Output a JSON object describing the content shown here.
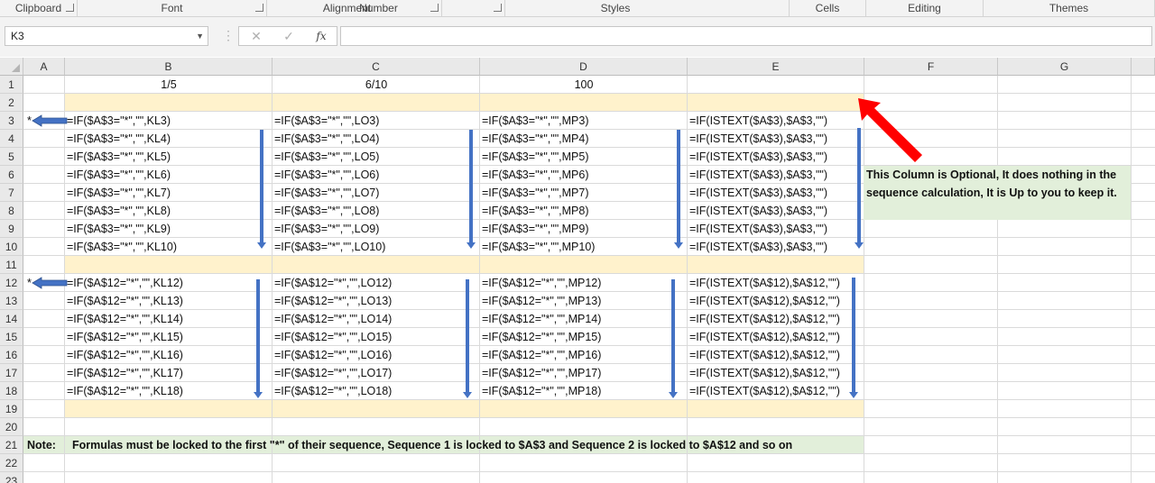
{
  "ribbon": {
    "groups": [
      {
        "label": "Clipboard",
        "launcher": true
      },
      {
        "label": "Font",
        "launcher": true
      },
      {
        "label": "Alignment",
        "launcher": true
      },
      {
        "label": "Number",
        "launcher": true
      },
      {
        "label": "Styles",
        "launcher": false
      },
      {
        "label": "Cells",
        "launcher": false
      },
      {
        "label": "Editing",
        "launcher": false
      },
      {
        "label": "Themes",
        "launcher": false
      }
    ]
  },
  "formula_bar": {
    "name_box": "K3",
    "cancel_icon": "close-icon",
    "enter_icon": "check-icon",
    "fx_label": "fx",
    "formula": ""
  },
  "columns": [
    "A",
    "B",
    "C",
    "D",
    "E",
    "F",
    "G"
  ],
  "rows": [
    "1",
    "2",
    "3",
    "4",
    "5",
    "6",
    "7",
    "8",
    "9",
    "10",
    "11",
    "12",
    "13",
    "14",
    "15",
    "16",
    "17",
    "18",
    "19",
    "20",
    "21",
    "22",
    "23"
  ],
  "cells": {
    "row1": {
      "B": "1/5",
      "C": "6/10",
      "D": "100"
    },
    "seq1": {
      "A3": "*",
      "B": [
        "=IF($A$3=\"*\",\"\",KL3)",
        "=IF($A$3=\"*\",\"\",KL4)",
        "=IF($A$3=\"*\",\"\",KL5)",
        "=IF($A$3=\"*\",\"\",KL6)",
        "=IF($A$3=\"*\",\"\",KL7)",
        "=IF($A$3=\"*\",\"\",KL8)",
        "=IF($A$3=\"*\",\"\",KL9)",
        "=IF($A$3=\"*\",\"\",KL10)"
      ],
      "C": [
        "=IF($A$3=\"*\",\"\",LO3)",
        "=IF($A$3=\"*\",\"\",LO4)",
        "=IF($A$3=\"*\",\"\",LO5)",
        "=IF($A$3=\"*\",\"\",LO6)",
        "=IF($A$3=\"*\",\"\",LO7)",
        "=IF($A$3=\"*\",\"\",LO8)",
        "=IF($A$3=\"*\",\"\",LO9)",
        "=IF($A$3=\"*\",\"\",LO10)"
      ],
      "D": [
        "=IF($A$3=\"*\",\"\",MP3)",
        "=IF($A$3=\"*\",\"\",MP4)",
        "=IF($A$3=\"*\",\"\",MP5)",
        "=IF($A$3=\"*\",\"\",MP6)",
        "=IF($A$3=\"*\",\"\",MP7)",
        "=IF($A$3=\"*\",\"\",MP8)",
        "=IF($A$3=\"*\",\"\",MP9)",
        "=IF($A$3=\"*\",\"\",MP10)"
      ],
      "E": [
        "=IF(ISTEXT($A$3),$A$3,\"\")",
        "=IF(ISTEXT($A$3),$A$3,\"\")",
        "=IF(ISTEXT($A$3),$A$3,\"\")",
        "=IF(ISTEXT($A$3),$A$3,\"\")",
        "=IF(ISTEXT($A$3),$A$3,\"\")",
        "=IF(ISTEXT($A$3),$A$3,\"\")",
        "=IF(ISTEXT($A$3),$A$3,\"\")",
        "=IF(ISTEXT($A$3),$A$3,\"\")"
      ]
    },
    "seq2": {
      "A12": "*",
      "B": [
        "=IF($A$12=\"*\",\"\",KL12)",
        "=IF($A$12=\"*\",\"\",KL13)",
        "=IF($A$12=\"*\",\"\",KL14)",
        "=IF($A$12=\"*\",\"\",KL15)",
        "=IF($A$12=\"*\",\"\",KL16)",
        "=IF($A$12=\"*\",\"\",KL17)",
        "=IF($A$12=\"*\",\"\",KL18)"
      ],
      "C": [
        "=IF($A$12=\"*\",\"\",LO12)",
        "=IF($A$12=\"*\",\"\",LO13)",
        "=IF($A$12=\"*\",\"\",LO14)",
        "=IF($A$12=\"*\",\"\",LO15)",
        "=IF($A$12=\"*\",\"\",LO16)",
        "=IF($A$12=\"*\",\"\",LO17)",
        "=IF($A$12=\"*\",\"\",LO18)"
      ],
      "D": [
        "=IF($A$12=\"*\",\"\",MP12)",
        "=IF($A$12=\"*\",\"\",MP13)",
        "=IF($A$12=\"*\",\"\",MP14)",
        "=IF($A$12=\"*\",\"\",MP15)",
        "=IF($A$12=\"*\",\"\",MP16)",
        "=IF($A$12=\"*\",\"\",MP17)",
        "=IF($A$12=\"*\",\"\",MP18)"
      ],
      "E": [
        "=IF(ISTEXT($A$12),$A$12,\"\")",
        "=IF(ISTEXT($A$12),$A$12,\"\")",
        "=IF(ISTEXT($A$12),$A$12,\"\")",
        "=IF(ISTEXT($A$12),$A$12,\"\")",
        "=IF(ISTEXT($A$12),$A$12,\"\")",
        "=IF(ISTEXT($A$12),$A$12,\"\")",
        "=IF(ISTEXT($A$12),$A$12,\"\")"
      ]
    },
    "note_row21": {
      "label": "Note:",
      "text": "Formulas must be locked to the first \"*\" of their sequence, Sequence 1 is locked to $A$3 and Sequence 2 is locked to $A$12 and so on"
    },
    "side_note": {
      "line1": "This Column is Optional, It does nothing in the",
      "line2": "sequence calculation, It is Up to you to keep it."
    }
  },
  "colors": {
    "separator_band": "#fff2cc",
    "note_fill": "#e2efda",
    "blue_arrow": "#4472c4",
    "red_arrow": "#ff0000"
  }
}
